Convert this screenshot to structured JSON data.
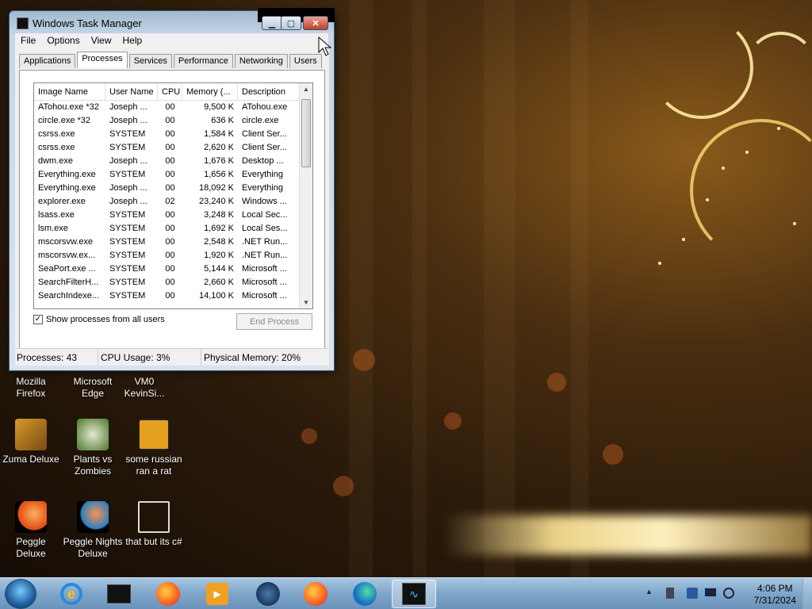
{
  "window": {
    "title": "Windows Task Manager",
    "menu": [
      "File",
      "Options",
      "View",
      "Help"
    ],
    "tabs": [
      "Applications",
      "Processes",
      "Services",
      "Performance",
      "Networking",
      "Users"
    ],
    "active_tab": "Processes",
    "columns": [
      "Image Name",
      "User Name",
      "CPU",
      "Memory (...",
      "Description"
    ],
    "processes": [
      [
        "ATohou.exe *32",
        "Joseph ...",
        "00",
        "9,500 K",
        "ATohou.exe"
      ],
      [
        "circle.exe *32",
        "Joseph ...",
        "00",
        "636 K",
        "circle.exe"
      ],
      [
        "csrss.exe",
        "SYSTEM",
        "00",
        "1,584 K",
        "Client Ser..."
      ],
      [
        "csrss.exe",
        "SYSTEM",
        "00",
        "2,620 K",
        "Client Ser..."
      ],
      [
        "dwm.exe",
        "Joseph ...",
        "00",
        "1,676 K",
        "Desktop ..."
      ],
      [
        "Everything.exe",
        "SYSTEM",
        "00",
        "1,656 K",
        "Everything"
      ],
      [
        "Everything.exe",
        "Joseph ...",
        "00",
        "18,092 K",
        "Everything"
      ],
      [
        "explorer.exe",
        "Joseph ...",
        "02",
        "23,240 K",
        "Windows ..."
      ],
      [
        "lsass.exe",
        "SYSTEM",
        "00",
        "3,248 K",
        "Local Sec..."
      ],
      [
        "lsm.exe",
        "SYSTEM",
        "00",
        "1,692 K",
        "Local Ses..."
      ],
      [
        "mscorsvw.exe",
        "SYSTEM",
        "00",
        "2,548 K",
        ".NET Run..."
      ],
      [
        "mscorsvw.ex...",
        "SYSTEM",
        "00",
        "1,920 K",
        ".NET Run..."
      ],
      [
        "SeaPort.exe ...",
        "SYSTEM",
        "00",
        "5,144 K",
        "Microsoft ..."
      ],
      [
        "SearchFilterH...",
        "SYSTEM",
        "00",
        "2,660 K",
        "Microsoft ..."
      ],
      [
        "SearchIndexe...",
        "SYSTEM",
        "00",
        "14,100 K",
        "Microsoft ..."
      ]
    ],
    "show_all_label": "Show processes from all users",
    "show_all_checked": "✓",
    "end_process_label": "End Process",
    "status": {
      "processes": "Processes: 43",
      "cpu": "CPU Usage: 3%",
      "memory": "Physical Memory: 20%"
    },
    "buttons": {
      "minimize": "▁",
      "maximize": "▢",
      "close": "✕"
    }
  },
  "desktop_icons": [
    {
      "label": "Mozilla\nFirefox",
      "icon": "firefox-icon"
    },
    {
      "label": "Microsoft\nEdge",
      "icon": "edge-icon"
    },
    {
      "label": "VM0\nKevinSi...",
      "icon": "vm-icon"
    },
    {
      "label": "Zuma Deluxe",
      "icon": "zuma-icon"
    },
    {
      "label": "Plants vs\nZombies",
      "icon": "pvz-icon"
    },
    {
      "label": "some russian\nran a rat",
      "icon": "java-icon"
    },
    {
      "label": "Peggle Deluxe",
      "icon": "peggle-icon"
    },
    {
      "label": "Peggle Nights\nDeluxe",
      "icon": "peggle-nights-icon"
    },
    {
      "label": "that but its c#",
      "icon": "shortcut-icon"
    }
  ],
  "taskbar": {
    "clock_time": "4:06 PM",
    "clock_date": "7/31/2024",
    "tray_arrow": "▲"
  }
}
